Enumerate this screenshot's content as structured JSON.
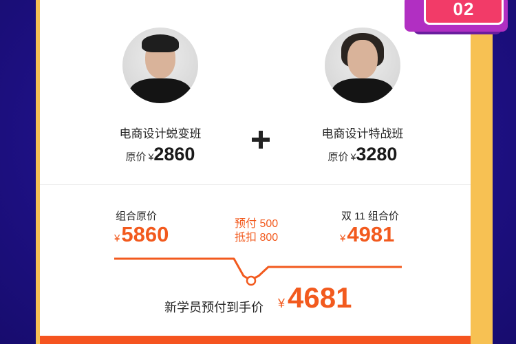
{
  "badge": {
    "number": "02"
  },
  "teachers": [
    {
      "course": "电商设计蜕变班",
      "price_prefix": "原价",
      "currency": "¥",
      "price": "2860"
    },
    {
      "course": "电商设计特战班",
      "price_prefix": "原价",
      "currency": "¥",
      "price": "3280"
    }
  ],
  "plus_icon": "plus-icon",
  "combo": {
    "original_label": "组合原价",
    "original_currency": "¥",
    "original_price": "5860",
    "discount_line1": "预付 500",
    "discount_line2": "抵扣 800",
    "double11_label": "双 11 组合价",
    "double11_currency": "¥",
    "double11_price": "4981"
  },
  "final": {
    "label": "新学员预付到手价",
    "currency": "¥",
    "price": "4681"
  },
  "colors": {
    "background": "#20128a",
    "accent_orange": "#f25a1e",
    "panel_yellow": "#f7c153",
    "badge_pink": "#f23b68",
    "badge_purple": "#b12fc2"
  }
}
